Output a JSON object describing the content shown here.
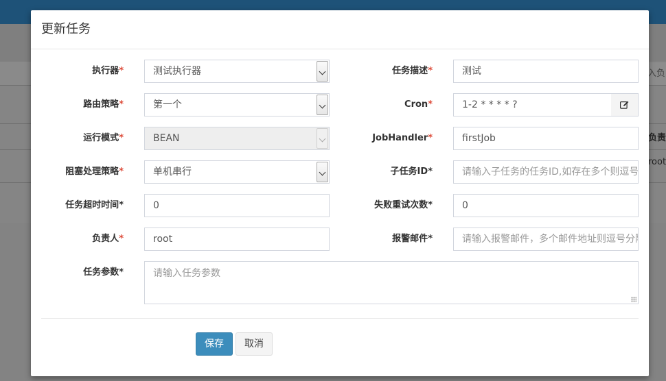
{
  "modal": {
    "title": "更新任务",
    "save_label": "保存",
    "cancel_label": "取消"
  },
  "form": {
    "executor": {
      "label": "执行器",
      "required": "*",
      "value": "测试执行器"
    },
    "route": {
      "label": "路由策略",
      "required": "*",
      "value": "第一个"
    },
    "glue_type": {
      "label": "运行模式",
      "required": "*",
      "value": "BEAN"
    },
    "block": {
      "label": "阻塞处理策略",
      "required": "*",
      "value": "单机串行"
    },
    "timeout": {
      "label": "任务超时时间",
      "star": "*",
      "value": "0"
    },
    "author": {
      "label": "负责人",
      "required": "*",
      "value": "root"
    },
    "param": {
      "label": "任务参数",
      "star": "*",
      "placeholder": "请输入任务参数"
    },
    "desc": {
      "label": "任务描述",
      "required": "*",
      "value": "测试"
    },
    "cron": {
      "label": "Cron",
      "required": "*",
      "value": "1-2 * * * * ?"
    },
    "handler": {
      "label": "JobHandler",
      "required": "*",
      "value": "firstJob"
    },
    "child": {
      "label": "子任务ID",
      "star": "*",
      "placeholder": "请输入子任务的任务ID,如存在多个则逗号分隔"
    },
    "retry": {
      "label": "失败重试次数",
      "star": "*",
      "value": "0"
    },
    "alarm": {
      "label": "报警邮件",
      "star": "*",
      "placeholder": "请输入报警邮件，多个邮件地址则逗号分隔"
    }
  },
  "background": {
    "search_placeholder": "输入负",
    "col_header": "负责",
    "cell_author": "root"
  },
  "colors": {
    "primary": "#3c8dbc",
    "required": "#dd4b39",
    "header": "#1e5278"
  }
}
